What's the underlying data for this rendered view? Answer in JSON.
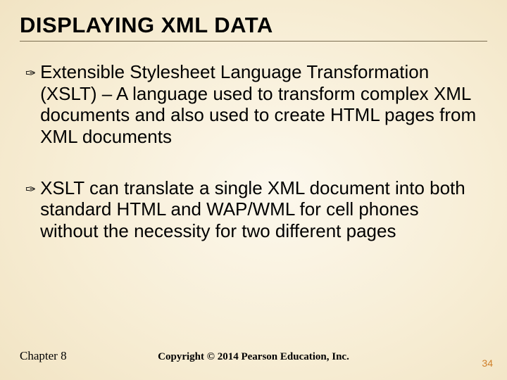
{
  "title": "DISPLAYING XML DATA",
  "bullets": [
    "Extensible Stylesheet Language Transformation (XSLT) – A language used to transform complex XML documents and also used to create HTML pages from XML documents",
    "XSLT can translate a single XML document into both standard HTML and WAP/WML for cell phones without the necessity for two different pages"
  ],
  "footer_left": "Chapter 8",
  "footer_center": "Copyright © 2014 Pearson Education, Inc.",
  "page_number": "34",
  "bullet_glyph": "✑"
}
